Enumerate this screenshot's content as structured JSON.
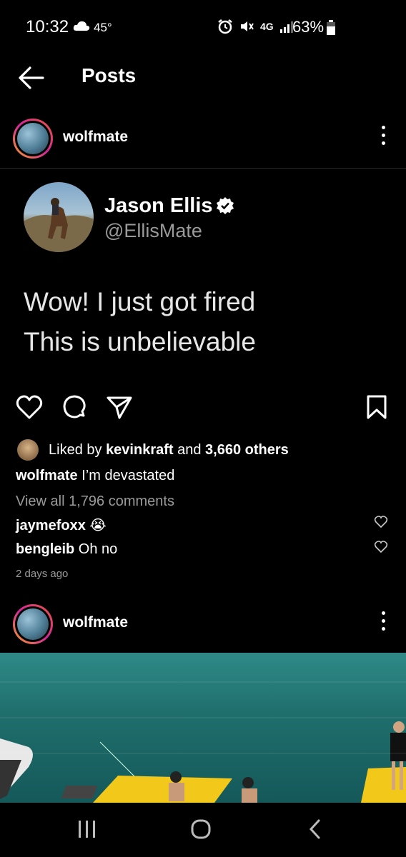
{
  "status_bar": {
    "time": "10:32",
    "temperature": "45°",
    "battery_percent": "63%",
    "network": "4G"
  },
  "header": {
    "title": "Posts"
  },
  "post": {
    "username": "wolfmate",
    "tweet": {
      "name": "Jason Ellis",
      "handle": "@EllisMate",
      "line1": "Wow! I just got fired",
      "line2": "This is unbelievable"
    },
    "likes": {
      "prefix": "Liked by ",
      "user": "kevinkraft",
      "middle": " and ",
      "others": "3,660 others"
    },
    "caption": {
      "username": "wolfmate",
      "text": " I’m devastated"
    },
    "view_comments": "View all 1,796 comments",
    "comments": [
      {
        "username": "jaymefoxx",
        "text": " 😭"
      },
      {
        "username": "bengleib",
        "text": " Oh no"
      }
    ],
    "timestamp": "2 days ago"
  },
  "next_post": {
    "username": "wolfmate"
  },
  "colors": {
    "background": "#000000",
    "secondary_text": "#9a9a9a",
    "story_ring": "#d6249f"
  }
}
